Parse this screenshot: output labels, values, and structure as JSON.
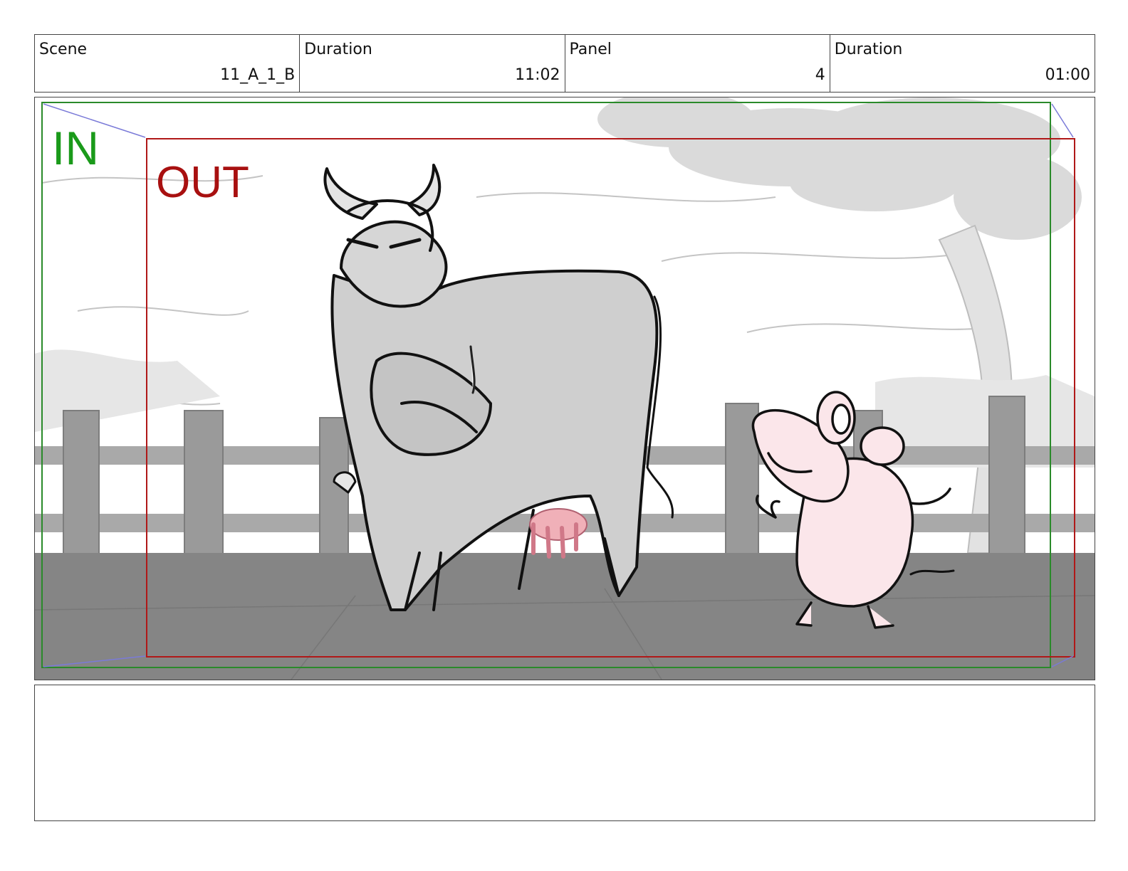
{
  "header": {
    "scene_label": "Scene",
    "scene_value": "11_A_1_B",
    "duration_label": "Duration",
    "duration_value": "11:02",
    "panel_label": "Panel",
    "panel_value": "4",
    "panel_duration_label": "Duration",
    "panel_duration_value": "01:00"
  },
  "frame": {
    "in_label": "IN",
    "out_label": "OUT",
    "in_color": "#1a9a1a",
    "out_color": "#a81010"
  },
  "notes": {
    "text": ""
  }
}
